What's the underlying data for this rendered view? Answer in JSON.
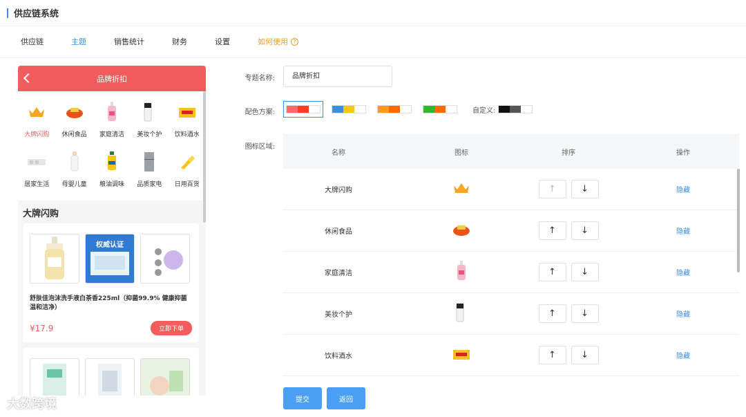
{
  "app": {
    "title": "供应链系统"
  },
  "nav": {
    "tabs": [
      "供应链",
      "主题",
      "销售统计",
      "财务",
      "设置"
    ],
    "active": 1,
    "help": "如何使用"
  },
  "preview": {
    "title": "品牌折扣",
    "categories": [
      "大牌闪购",
      "休闲食品",
      "家庭清洁",
      "美妆个护",
      "饮料酒水",
      "居家生活",
      "母婴儿童",
      "粮油调味",
      "品质家电",
      "日用百货"
    ],
    "section": "大牌闪购",
    "product": {
      "name": "舒肤佳泡沫洗手液白茶香225ml（抑菌99.9% 健康抑菌温和洁净）",
      "price": "¥17.9",
      "buy": "立即下单",
      "image_text": "权威认证"
    }
  },
  "form": {
    "name_label": "专题名称:",
    "name_value": "品牌折扣",
    "color_label": "配色方案:",
    "custom_label": "自定义:",
    "icon_label": "图标区域:",
    "palettes": [
      [
        "#ff6b6b",
        "#ff3d1f"
      ],
      [
        "#3a8ee6",
        "#f5c518"
      ],
      [
        "#ff9a1f",
        "#ff6a00"
      ],
      [
        "#2eb82e",
        "#ff6a00"
      ]
    ],
    "custom_palette": [
      "#111111",
      "#555555"
    ]
  },
  "table": {
    "headers": {
      "name": "名称",
      "icon": "图标",
      "sort": "排序",
      "action": "操作"
    },
    "rows": [
      {
        "name": "大牌闪购",
        "action": "隐藏"
      },
      {
        "name": "休闲食品",
        "action": "隐藏"
      },
      {
        "name": "家庭清洁",
        "action": "隐藏"
      },
      {
        "name": "美妆个护",
        "action": "隐藏"
      },
      {
        "name": "饮料酒水",
        "action": "隐藏"
      }
    ]
  },
  "buttons": {
    "submit": "提交",
    "back": "返回"
  },
  "watermark": "大数跨境"
}
